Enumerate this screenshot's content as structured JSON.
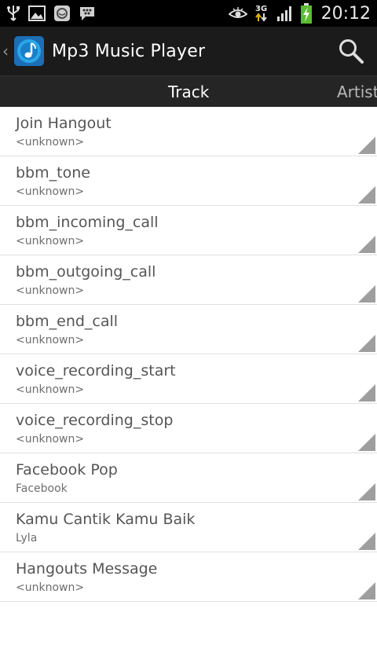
{
  "status_bar": {
    "time": "20:12",
    "network_type": "3G",
    "icons": [
      "usb-icon",
      "image-icon",
      "messenger-icon",
      "bbm-icon",
      "smart-stay-eye-icon",
      "data-arrows-icon",
      "signal-icon",
      "battery-charging-icon"
    ]
  },
  "action_bar": {
    "title": "Mp3 Music Player",
    "up_icon": "chevron-left-icon",
    "app_icon": "music-note-icon",
    "search_icon": "search-icon"
  },
  "tabs": [
    {
      "label": "Track",
      "selected": true
    },
    {
      "label": "Artist",
      "selected": false
    }
  ],
  "tracks": [
    {
      "title": "Join Hangout",
      "artist": "<unknown>"
    },
    {
      "title": "bbm_tone",
      "artist": "<unknown>"
    },
    {
      "title": "bbm_incoming_call",
      "artist": "<unknown>"
    },
    {
      "title": "bbm_outgoing_call",
      "artist": "<unknown>"
    },
    {
      "title": "bbm_end_call",
      "artist": "<unknown>"
    },
    {
      "title": "voice_recording_start",
      "artist": "<unknown>"
    },
    {
      "title": "voice_recording_stop",
      "artist": "<unknown>"
    },
    {
      "title": "Facebook Pop",
      "artist": "Facebook"
    },
    {
      "title": "Kamu Cantik Kamu Baik",
      "artist": "Lyla"
    },
    {
      "title": "Hangouts Message",
      "artist": "<unknown>"
    }
  ],
  "colors": {
    "status_bar": "#000000",
    "action_bar": "#1b1b1b",
    "tab_bar": "#252525",
    "title_text": "#555555",
    "subtitle_text": "#6e6e6e",
    "corner_triangle": "#9e9e9e",
    "accent_blue": "#2aa7e8"
  }
}
